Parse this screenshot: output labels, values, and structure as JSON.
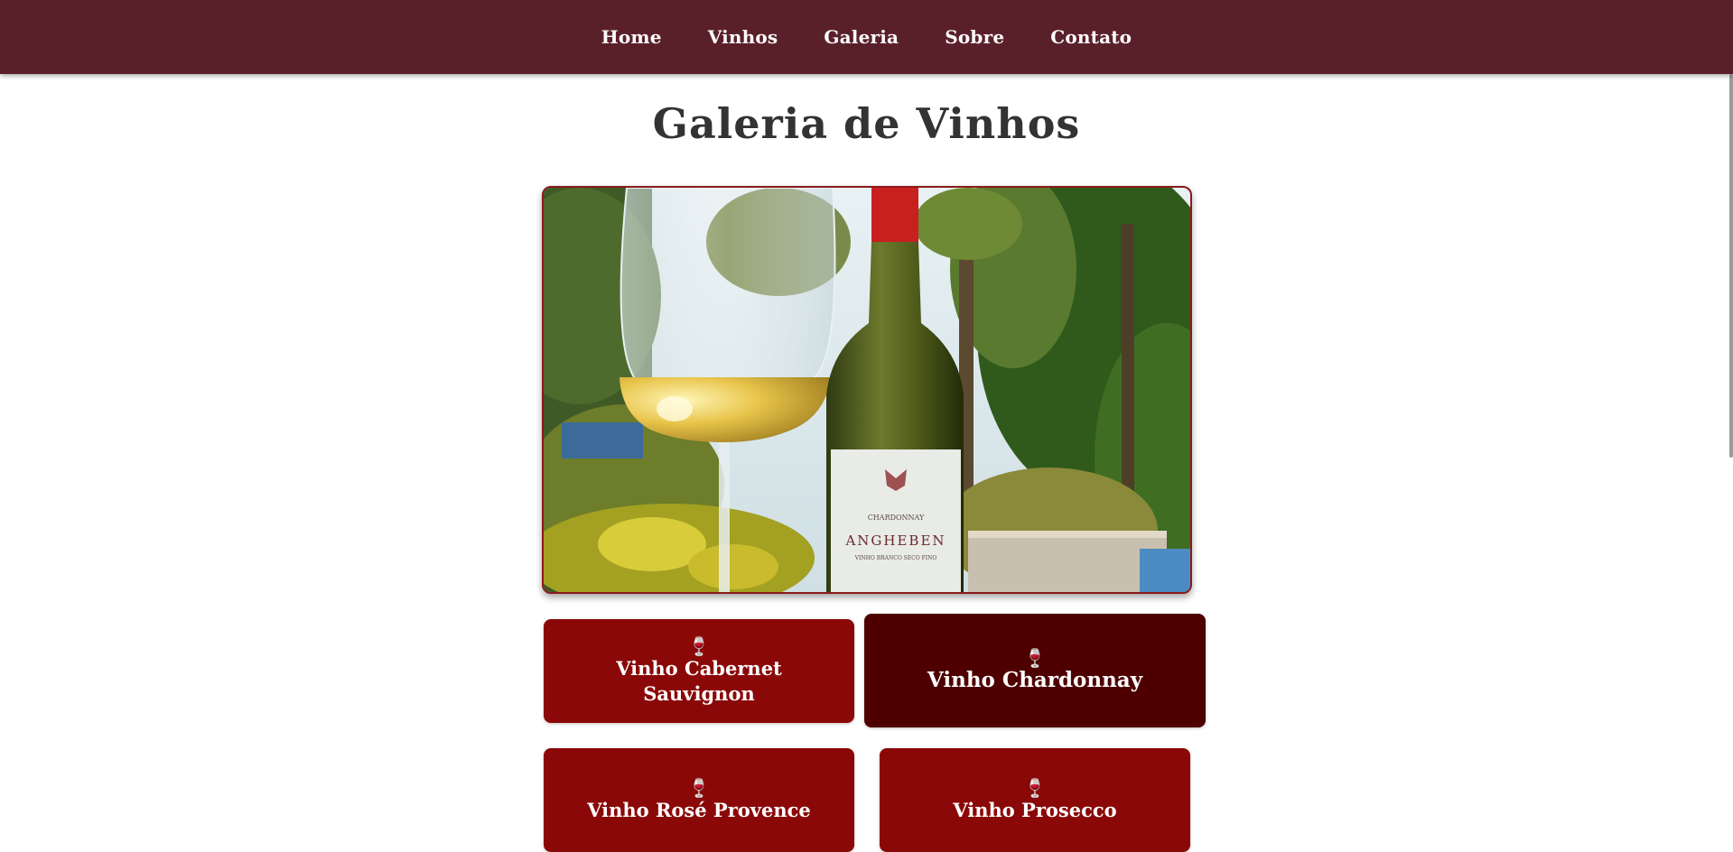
{
  "nav": {
    "items": [
      {
        "label": "Home"
      },
      {
        "label": "Vinhos"
      },
      {
        "label": "Galeria"
      },
      {
        "label": "Sobre"
      },
      {
        "label": "Contato"
      }
    ]
  },
  "main": {
    "title": "Galeria de Vinhos",
    "hero": {
      "bottle_label": {
        "variety": "CHARDONNAY",
        "brand": "ANGHEBEN",
        "subtitle": "VINHO BRANCO SECO FINO"
      }
    },
    "cards": [
      {
        "icon": "wine-glass-icon",
        "label": "Vinho Cabernet Sauvignon",
        "active": false
      },
      {
        "icon": "wine-glass-icon",
        "label": "Vinho Chardonnay",
        "active": true
      },
      {
        "icon": "wine-glass-icon",
        "label": "Vinho Rosé Provence",
        "active": false
      },
      {
        "icon": "wine-glass-icon",
        "label": "Vinho Prosecco",
        "active": false
      }
    ]
  },
  "colors": {
    "nav_bg": "#5a2029",
    "card_bg": "#8b0808",
    "card_active_bg": "#4e0000",
    "title": "#333333"
  }
}
